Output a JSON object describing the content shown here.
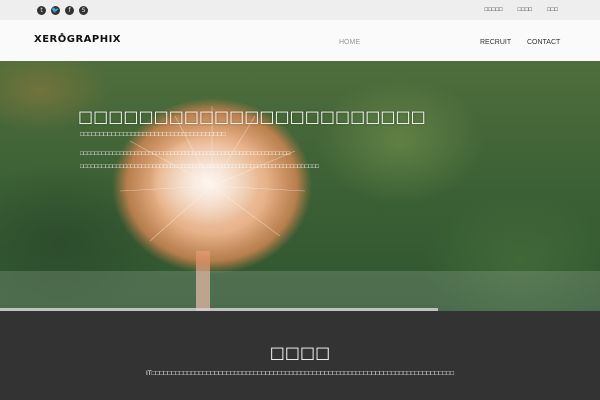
{
  "topbar": {
    "social": [
      {
        "icon": "tumblr-icon",
        "glyph": "t"
      },
      {
        "icon": "twitter-icon",
        "glyph": "🐦"
      },
      {
        "icon": "facebook-icon",
        "glyph": "f"
      },
      {
        "icon": "skype-icon",
        "glyph": "S"
      }
    ],
    "links": [
      "□□□□□",
      "□□□□",
      "□□□"
    ]
  },
  "header": {
    "logo": "XERO̊GRAPHIX",
    "nav": {
      "home": "HOME",
      "recruit": "RECRUIT",
      "contact": "CONTACT"
    }
  },
  "hero": {
    "title": "□□□□□□□□□□□□□□□□□□□□□□□",
    "subtitle": "□□□□□□□□□□□□□□□□□□□□□□□□□□□□□□□□□□□□□",
    "line1": "□□□□□□□□□□□□□□□□□□□□□□□□□□□□□□□□□□□□□□□□□□□□□□□□□□□□□□□□□□",
    "line2": "□□□□□□□□□□□□□□□□□□□□□□□□□□□□□□□□□□□□□□□□□□□□□□□□□□□□□□□□□□□□□□□□□□",
    "slide_progress": 0.73
  },
  "about": {
    "title": "□□□□",
    "text": "IT□□□□□□□□□□□□□□□□□□□□□□□□□□□□□□□□□□□□□□□□□□□□□□□□□□□□□□□□□□□□□□□□□□□□□□□□□□□□□"
  },
  "colors": {
    "topbar": "#eeeeee",
    "header": "#fafafa",
    "dark": "#333333",
    "nav_active": "#999999"
  }
}
